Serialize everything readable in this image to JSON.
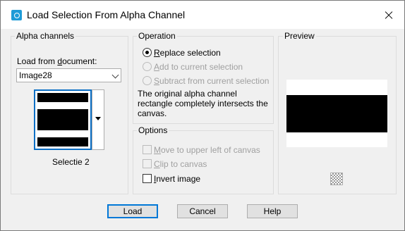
{
  "window": {
    "title": "Load Selection From Alpha Channel"
  },
  "alpha_channels": {
    "group_title": "Alpha channels",
    "load_from_label_pre": "Load from ",
    "load_from_label_key": "d",
    "load_from_label_post": "ocument:",
    "document_value": "Image28",
    "channel_name": "Selectie 2"
  },
  "operation": {
    "group_title": "Operation",
    "options": [
      {
        "pre": "",
        "key": "R",
        "post": "eplace selection",
        "selected": true,
        "enabled": true
      },
      {
        "pre": "",
        "key": "A",
        "post": "dd to current selection",
        "selected": false,
        "enabled": false
      },
      {
        "pre": "",
        "key": "S",
        "post": "ubtract from current selection",
        "selected": false,
        "enabled": false
      }
    ],
    "description": "The original alpha channel rectangle completely intersects the canvas."
  },
  "options": {
    "group_title": "Options",
    "items": [
      {
        "pre": "",
        "key": "M",
        "post": "ove to upper left of canvas",
        "checked": false,
        "enabled": false
      },
      {
        "pre": "",
        "key": "C",
        "post": "lip to canvas",
        "checked": false,
        "enabled": false
      },
      {
        "pre": "",
        "key": "I",
        "post": "nvert image",
        "checked": false,
        "enabled": true
      }
    ]
  },
  "preview": {
    "group_title": "Preview",
    "icon": "transparency-checker-icon"
  },
  "buttons": {
    "load": "Load",
    "cancel": "Cancel",
    "help": "Help"
  },
  "colors": {
    "accent": "#0078d7",
    "app_icon": "#1e9bd7"
  }
}
